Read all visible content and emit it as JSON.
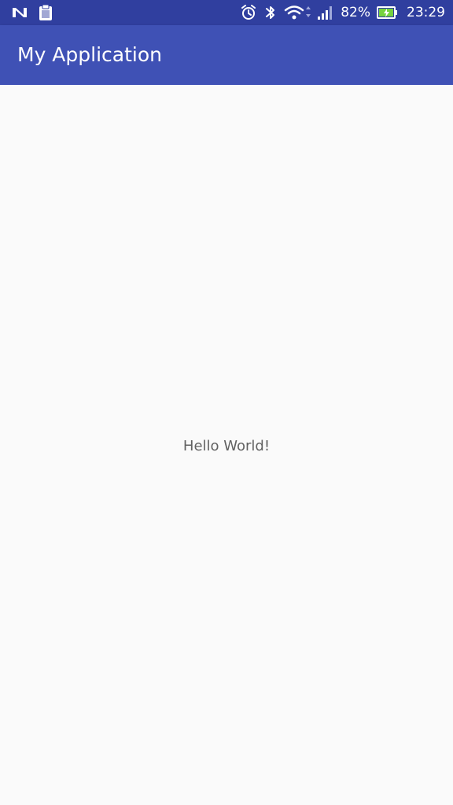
{
  "status_bar": {
    "background": "#303f9f",
    "left_icons": [
      "n-notification-icon",
      "clipboard-notification-icon"
    ],
    "right_icons": [
      "alarm-icon",
      "bluetooth-icon",
      "wifi-icon",
      "signal-icon",
      "battery-charging-icon"
    ],
    "battery_percent": "82%",
    "time": "23:29"
  },
  "app_bar": {
    "background": "#3f51b5",
    "title": "My Application"
  },
  "main": {
    "background": "#fafafa",
    "message": "Hello World!"
  }
}
